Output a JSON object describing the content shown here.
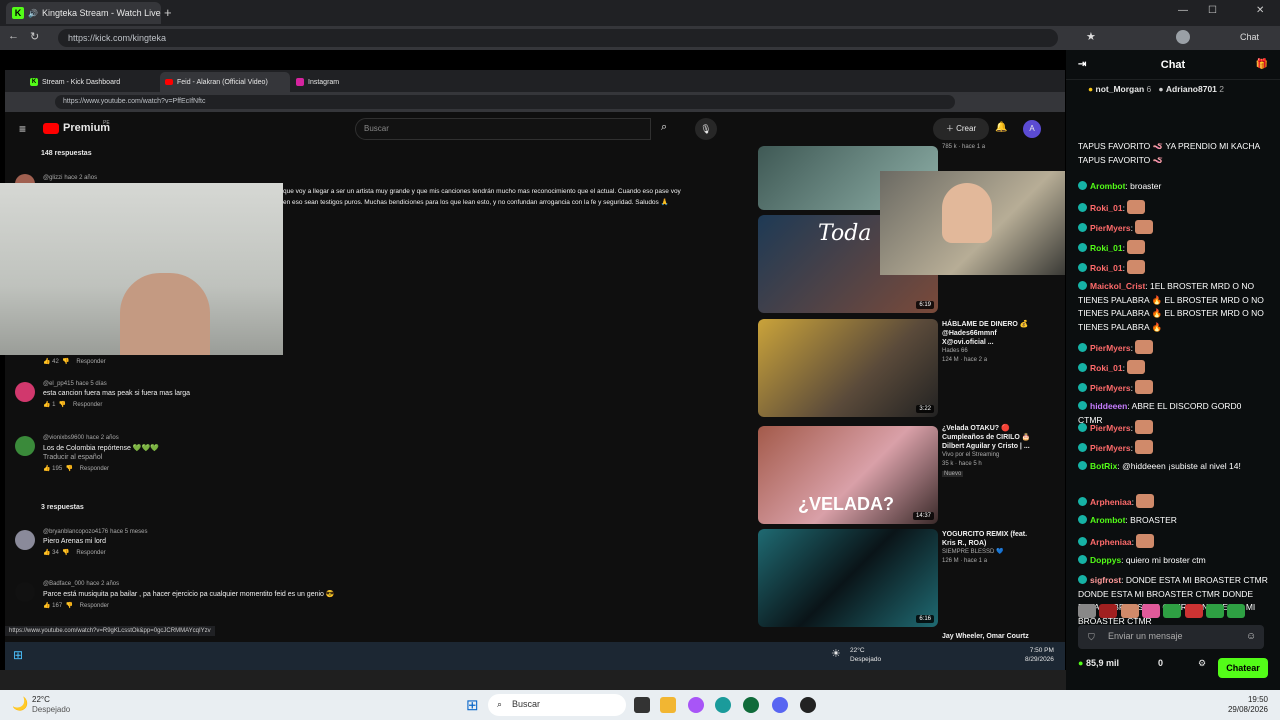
{
  "browser": {
    "tabs": [
      {
        "label": "Kingteka Stream - Watch Live"
      }
    ],
    "url": "https://kick.com/kingteka",
    "chat_label": "Chat"
  },
  "inner": {
    "tabs": [
      {
        "label": "Stream - Kick Dashboard"
      },
      {
        "label": "Feid - Alakran (Official Video)"
      },
      {
        "label": "Instagram"
      }
    ],
    "url": "https://www.youtube.com/watch?v=PffEcIfNftc",
    "status_url": "https://www.youtube.com/watch?v=R9gKLcsstOk&pp=0gcJCRMMAYcqIYzv"
  },
  "youtube": {
    "brand": "Premium",
    "brand_sup": "PE",
    "search_placeholder": "Buscar",
    "create_label": "Crear",
    "avatar_letter": "A",
    "replies_top": "148 respuestas",
    "comments": [
      {
        "user": "@glizzi",
        "time": "hace 2 años",
        "text": "que voy a llegar a ser un artista muy grande y que mis canciones tendrán mucho mas reconocimiento que el actual. Cuando eso pase voy",
        "text2": "en eso sean testigos puros. Muchas bendiciones para los que lean esto, y no confundan arrogancia con la fe y seguridad. Saludos 🙏",
        "likes": "42",
        "reply": "Responder"
      },
      {
        "user": "@el_pp415",
        "time": "hace 5 días",
        "text": "esta cancion fuera mas peak si fuera mas larga",
        "likes": "1",
        "reply": "Responder"
      },
      {
        "user": "@vionixbs9600",
        "time": "hace 2 años",
        "text": "Los de Colombia repórtense 💚💚💚",
        "translate": "Traducir al español",
        "likes": "195",
        "reply": "Responder"
      },
      {
        "user": "@bryanblancopozo4176",
        "time": "hace 5 meses",
        "text": "Piero Arenas mi lord",
        "likes": "34",
        "reply": "Responder"
      },
      {
        "user": "@Badface_000",
        "time": "hace 2 años",
        "text": "Parce está musiquita pa bailar , pa hacer ejercicio pa cualquier momentito feid es un genio 😎",
        "likes": "167",
        "reply": "Responder"
      }
    ],
    "replies_mid": "3 respuestas",
    "videos": [
      {
        "title": "",
        "meta": "785 k · hace 1 a",
        "duration": ""
      },
      {
        "title": "",
        "meta": "",
        "duration": "6:19"
      },
      {
        "title": "HÁBLAME DE DINERO 💰 @Hades66mmnf X@ovi.oficial ...",
        "channel": "Hades 66",
        "meta": "124 M · hace 2 a",
        "duration": "3:22"
      },
      {
        "title": "¿Velada OTAKU? 🔴 Cumpleaños de CIRILO 🎂 Dilbert Aguilar y Cristo | ...",
        "channel": "Vivo por el Streaming",
        "meta": "35 k · hace 5 h",
        "badge": "Nuevo",
        "duration": "14:37",
        "thumb_text": "¿VELADA?"
      },
      {
        "title": "YOGURCITO REMIX (feat. Kris R., ROA)",
        "channel": "SIEMPRE BLESSD 💙",
        "meta": "126 M · hace 1 a",
        "duration": "6:16"
      }
    ],
    "more_title": "Jay Wheeler, Omar Courtz",
    "thumb_text_2": "Toda"
  },
  "inner_taskbar": {
    "weather_temp": "22°C",
    "weather_desc": "Despejado",
    "time": "7:50 PM",
    "date": "8/29/2026"
  },
  "chat": {
    "title": "Chat",
    "top": [
      {
        "user": "not_Morgan",
        "n": "6"
      },
      {
        "user": "Adriano8701",
        "n": "2"
      }
    ],
    "messages": [
      {
        "user": "",
        "text": "TAPUS FAVORITO 🪱 YA PRENDIO MI KACHA TAPUS FAVORITO 🪱"
      },
      {
        "user": "Arombot",
        "text": "broaster",
        "color": "#53fc18"
      },
      {
        "user": "Roki_01",
        "text": "",
        "color": "#ff6b6b"
      },
      {
        "user": "PierMyers",
        "text": "",
        "color": "#ff6b6b"
      },
      {
        "user": "Roki_01",
        "text": "",
        "color": "#53fc18"
      },
      {
        "user": "Roki_01",
        "text": "",
        "color": "#ff6b6b"
      },
      {
        "user": "Maickol_Crist",
        "text": "1EL BROSTER MRD O NO TIENES PALABRA 🔥 EL BROSTER MRD O NO TIENES PALABRA 🔥 EL BROSTER MRD O NO TIENES PALABRA 🔥",
        "color": "#ff6b6b"
      },
      {
        "user": "PierMyers",
        "text": "",
        "color": "#ff6b6b"
      },
      {
        "user": "Roki_01",
        "text": "",
        "color": "#ff6b6b"
      },
      {
        "user": "PierMyers",
        "text": "",
        "color": "#ff6b6b"
      },
      {
        "user": "hiddeeen",
        "text": "ABRE EL DISCORD GORD0 CTMR",
        "color": "#c77dff"
      },
      {
        "user": "PierMyers",
        "text": "",
        "color": "#ff6b6b"
      },
      {
        "user": "PierMyers",
        "text": "",
        "color": "#ff6b6b"
      },
      {
        "user": "BotRix",
        "text": "@hiddeeen ¡subiste al nivel 14!",
        "color": "#53fc18"
      },
      {
        "user": "Arpheniaa",
        "text": "",
        "color": "#ff6b6b"
      },
      {
        "user": "Arombot",
        "text": "BROASTER",
        "color": "#53fc18"
      },
      {
        "user": "Arpheniaa",
        "text": "",
        "color": "#ff6b6b"
      },
      {
        "user": "Doppys",
        "text": "quiero mi broster ctm",
        "color": "#53fc18"
      },
      {
        "user": "sigfrost",
        "text": "DONDE ESTA MI BROASTER CTMR DONDE ESTA MI BROASTER CTMR DONDE ESTA MI BROASTER CTMR DONDE ESTA MI BROASTER CTMR",
        "color": "#ff9a9a"
      }
    ],
    "input_placeholder": "Enviar un mensaje",
    "viewers": "85,9 mil",
    "count": "0",
    "send_label": "Chatear"
  },
  "taskbar": {
    "weather_temp": "22°C",
    "weather_desc": "Despejado",
    "search": "Buscar",
    "time": "19:50",
    "date": "29/08/2026"
  }
}
